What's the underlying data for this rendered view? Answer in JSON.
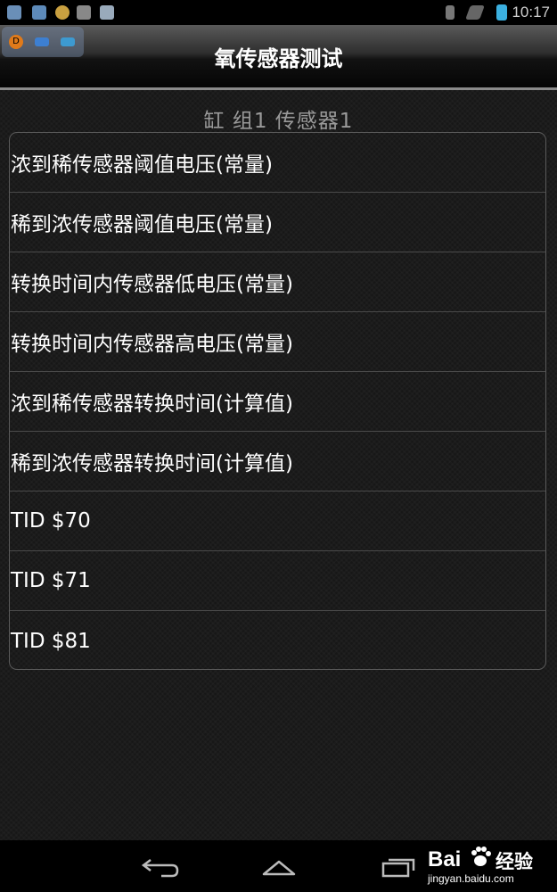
{
  "status_bar": {
    "time": "10:17",
    "icons": [
      "map-icon",
      "map-icon",
      "coin-icon",
      "sync-icon",
      "android-icon",
      "bluetooth-icon",
      "wifi-off-icon",
      "battery-charging-icon"
    ]
  },
  "overlay": {
    "buttons": [
      {
        "icon": "d-badge-icon",
        "label": "D",
        "color": "#e07a1a"
      },
      {
        "icon": "keyboard-icon",
        "color": "#3d7fd1"
      },
      {
        "icon": "window-icon",
        "color": "#3d9ad1"
      }
    ]
  },
  "header": {
    "title": "氧传感器测试"
  },
  "subtitle": "缸  组1  传感器1",
  "list": {
    "items": [
      {
        "label": "浓到稀传感器阈值电压(常量)"
      },
      {
        "label": "稀到浓传感器阈值电压(常量)"
      },
      {
        "label": "转换时间内传感器低电压(常量)"
      },
      {
        "label": "转换时间内传感器高电压(常量)"
      },
      {
        "label": "浓到稀传感器转换时间(计算值)"
      },
      {
        "label": "稀到浓传感器转换时间(计算值)"
      },
      {
        "label": "TID $70"
      },
      {
        "label": "TID $71"
      },
      {
        "label": "TID $81"
      }
    ]
  },
  "nav_bar": {
    "buttons": [
      "back-icon",
      "home-icon",
      "recent-apps-icon"
    ]
  },
  "watermark": {
    "brand": "Bai",
    "brand_suffix": "经验",
    "url": "jingyan.baidu.com"
  }
}
